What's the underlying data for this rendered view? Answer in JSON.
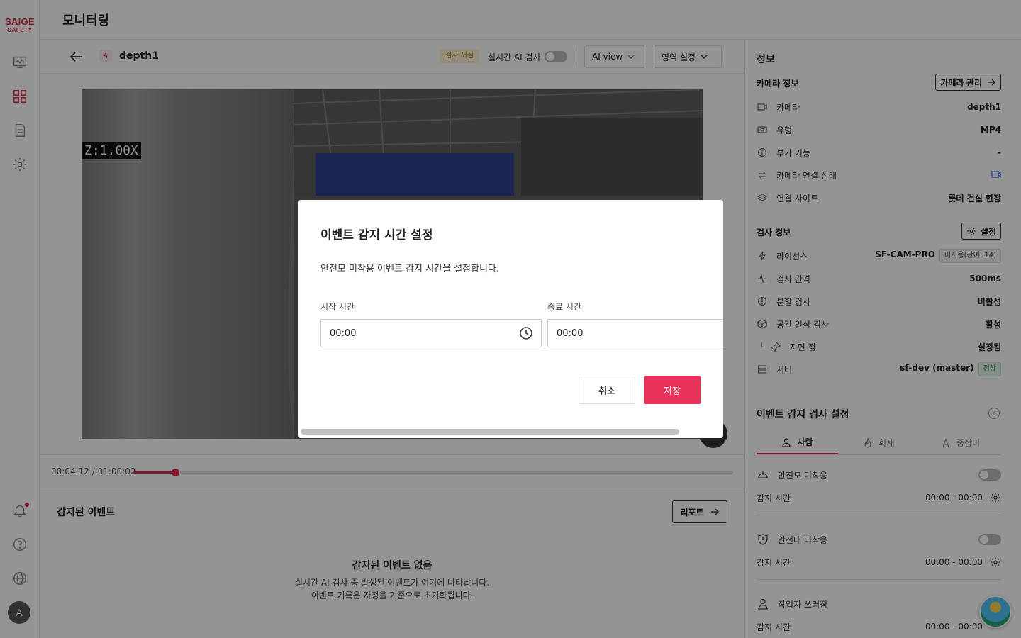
{
  "brand": {
    "line1": "SAIGE",
    "line2": "SAFETY",
    "accent": "#e12a4f"
  },
  "header": {
    "title": "모니터링"
  },
  "nav": [
    {
      "icon": "monitor-icon"
    },
    {
      "icon": "grid-icon",
      "active": true
    },
    {
      "icon": "document-icon"
    },
    {
      "icon": "gear-icon"
    }
  ],
  "nav_bottom": [
    {
      "icon": "bell-icon",
      "has_notification": true
    },
    {
      "icon": "help-icon"
    },
    {
      "icon": "globe-icon"
    }
  ],
  "user": {
    "avatar_letter": "A"
  },
  "camera": {
    "name": "depth1",
    "ai_status_badge": "검사 꺼짐",
    "realtime_ai_label": "실시간 AI 검사",
    "realtime_ai_on": false,
    "ai_view_label": "AI view",
    "region_label": "영역 설정"
  },
  "video": {
    "zoom_text": "Z:1.00X"
  },
  "playback": {
    "time_text": "00:04:12 / 01:00:02",
    "progress": 0.07
  },
  "events": {
    "title": "감지된 이벤트",
    "report_label": "리포트",
    "empty_title": "감지된 이벤트 없음",
    "empty_line1": "실시간 AI 검사 중 발생된 이벤트가 여기에 나타납니다.",
    "empty_line2": "이벤트 기록은 자정을 기준으로 초기화됩니다."
  },
  "info": {
    "title": "정보",
    "camera_section": "카메라 정보",
    "camera_manage_label": "카메라 관리",
    "camera_rows": [
      {
        "icon": "camera-icon",
        "label": "카메라",
        "value": "depth1"
      },
      {
        "icon": "video-type-icon",
        "label": "유형",
        "value": "MP4"
      },
      {
        "icon": "feature-icon",
        "label": "부가 기능",
        "value": "-"
      },
      {
        "icon": "connection-icon",
        "label": "카메라 연결 상태",
        "value": ""
      },
      {
        "icon": "layers-icon",
        "label": "연결 사이트",
        "value": "롯데 건설 현장"
      }
    ],
    "inspect_section": "검사 정보",
    "inspect_settings_label": "설정",
    "inspect_rows": [
      {
        "icon": "license-icon",
        "label": "라이선스",
        "value": "SF-CAM-PRO",
        "chip": "미사용(잔여: 14)"
      },
      {
        "icon": "pulse-icon",
        "label": "검사 간격",
        "value": "500ms"
      },
      {
        "icon": "split-icon",
        "label": "분할 검사",
        "value": "비활성"
      },
      {
        "icon": "cube-icon",
        "label": "공간 인식 검사",
        "value": "활성"
      },
      {
        "icon": "pin-icon",
        "label": "지면 점",
        "value": "설정됨",
        "indent": true
      },
      {
        "icon": "server-icon",
        "label": "서버",
        "value": "sf-dev (master)",
        "chip": "정상"
      }
    ]
  },
  "event_detection": {
    "title": "이벤트 감지 검사 설정",
    "tabs": [
      {
        "icon": "person-icon",
        "label": "사람",
        "active": true
      },
      {
        "icon": "fire-icon",
        "label": "화재"
      },
      {
        "icon": "equipment-icon",
        "label": "중장비"
      }
    ],
    "items": [
      {
        "icon": "helmet-icon",
        "label": "안전모 미착용",
        "time_label": "감지 시간",
        "time_value": "00:00 - 00:00",
        "enabled": false
      },
      {
        "icon": "shield-icon",
        "label": "안전대 미착용",
        "time_label": "감지 시간",
        "time_value": "00:00 - 00:00",
        "enabled": false
      },
      {
        "icon": "person-icon",
        "label": "작업자 쓰러짐",
        "time_label": "감지 시간",
        "time_value": "00:00 - 00:00",
        "enabled": false
      }
    ]
  },
  "modal": {
    "title": "이벤트 감지 시간 설정",
    "description": "안전모 미착용 이벤트 감지 시간을 설정합니다.",
    "start_label": "시작 시간",
    "start_value": "00:00",
    "end_label": "종료 시간",
    "end_value": "00:00",
    "cancel_label": "취소",
    "save_label": "저장",
    "save_color": "#e8325a"
  }
}
